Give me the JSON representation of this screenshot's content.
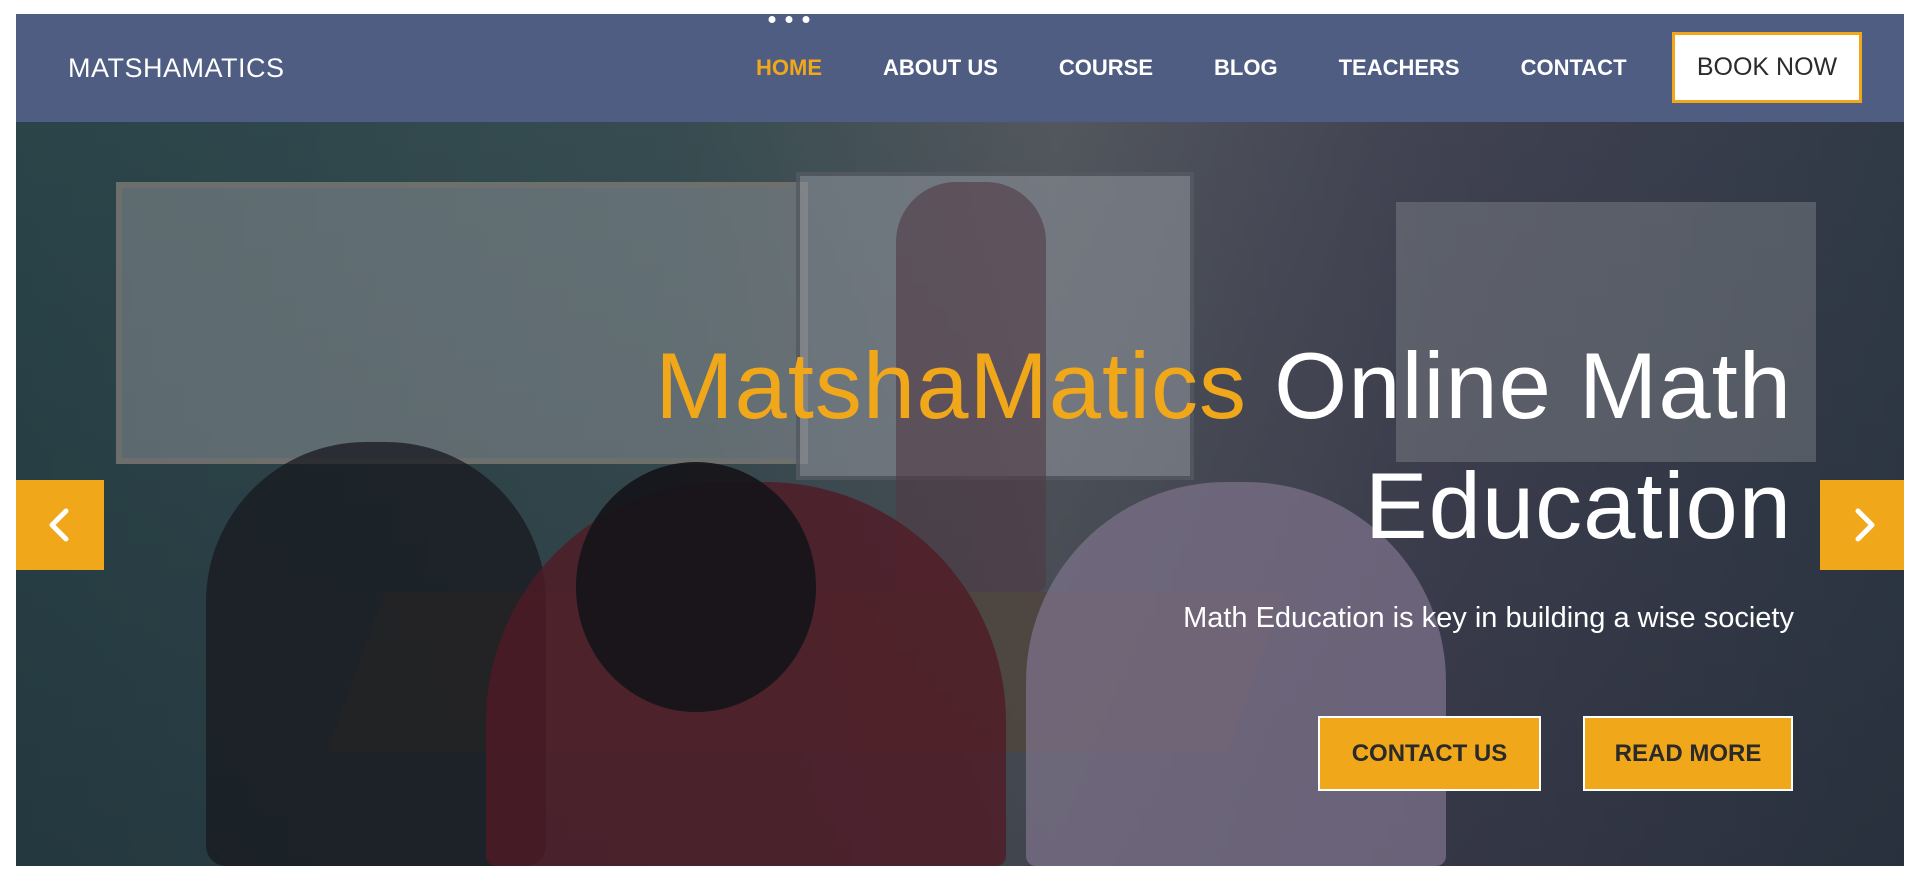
{
  "brand": {
    "name": "MATSHAMATICS"
  },
  "nav": {
    "items": [
      {
        "label": "HOME",
        "active": true
      },
      {
        "label": "ABOUT US",
        "active": false
      },
      {
        "label": "COURSE",
        "active": false
      },
      {
        "label": "BLOG",
        "active": false
      },
      {
        "label": "TEACHERS",
        "active": false
      },
      {
        "label": "CONTACT",
        "active": false
      }
    ],
    "cta": "BOOK NOW"
  },
  "hero": {
    "title_brand": "MatshaMatics",
    "title_rest": " Online Math Education",
    "subtitle": "Math Education is key in building a wise society",
    "buttons": {
      "contact": "CONTACT US",
      "read_more": "READ MORE"
    }
  },
  "colors": {
    "navbar": "#4f5d83",
    "accent": "#f0a71a",
    "text_light": "#ffffff"
  },
  "icons": {
    "prev": "chevron-left-icon",
    "next": "chevron-right-icon",
    "active_indicator": "three-dots-icon"
  }
}
